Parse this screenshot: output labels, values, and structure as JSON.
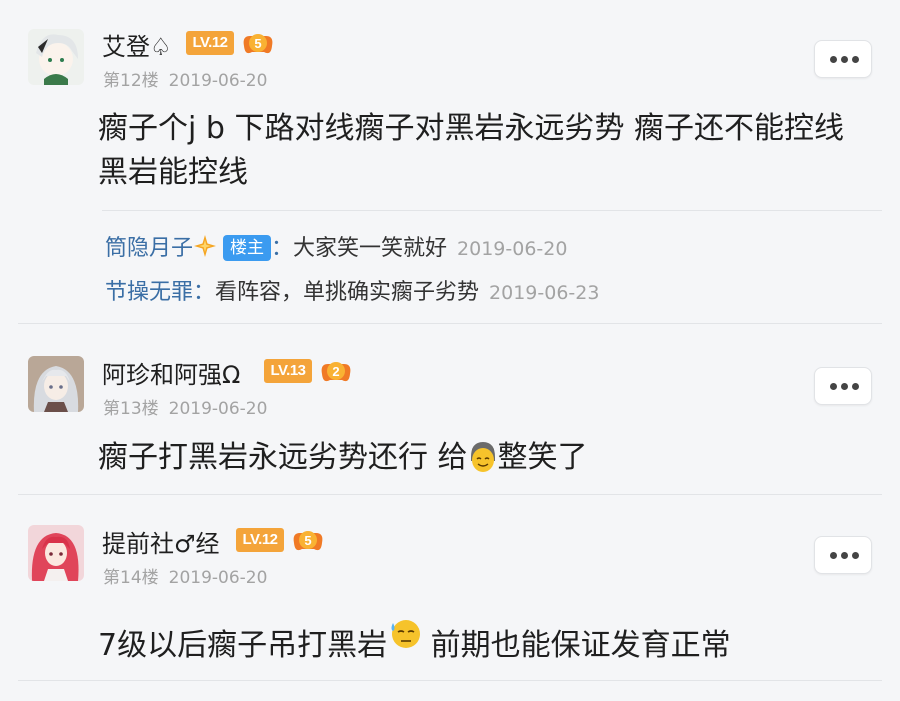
{
  "posts": [
    {
      "username": "艾登♤",
      "level": "LV.12",
      "badge_number": "5",
      "floor": "第12楼",
      "date": "2019-06-20",
      "content_line1": "瘸子个j b 下路对线瘸子对黑岩永远劣势 瘸子还不能控线",
      "content_line2": "黑岩能控线",
      "replies": [
        {
          "name": "筒隐月子",
          "is_op_label": "楼主",
          "sep": "：",
          "text": "大家笑一笑就好",
          "date": "2019-06-20"
        },
        {
          "name": "节操无罪",
          "sep": "：",
          "text": "看阵容，单挑确实瘸子劣势",
          "date": "2019-06-23"
        }
      ]
    },
    {
      "username": "阿珍和阿强Ω",
      "level": "LV.13",
      "badge_number": "2",
      "floor": "第13楼",
      "date": "2019-06-20",
      "content_before": "瘸子打黑岩永远劣势还行 给",
      "content_after": "整笑了"
    },
    {
      "username": "提前社♂经",
      "level": "LV.12",
      "badge_number": "5",
      "floor": "第14楼",
      "date": "2019-06-20",
      "content_before": "7级以后瘸子吊打黑岩",
      "content_after": " 前期也能保证发育正常"
    }
  ],
  "icons": {
    "more": "more-dots-icon",
    "badge": "game-controller-badge-icon",
    "sparkle": "sparkle-icon",
    "emoji_smile": "smiling-face-emoji",
    "emoji_sweat": "sweat-face-emoji"
  },
  "colors": {
    "background": "#f5f6f8",
    "level_badge": "#f4a43a",
    "reply_name": "#3a6ea5",
    "op_label": "#3b9bf0",
    "meta_text": "#a3a3a3"
  }
}
